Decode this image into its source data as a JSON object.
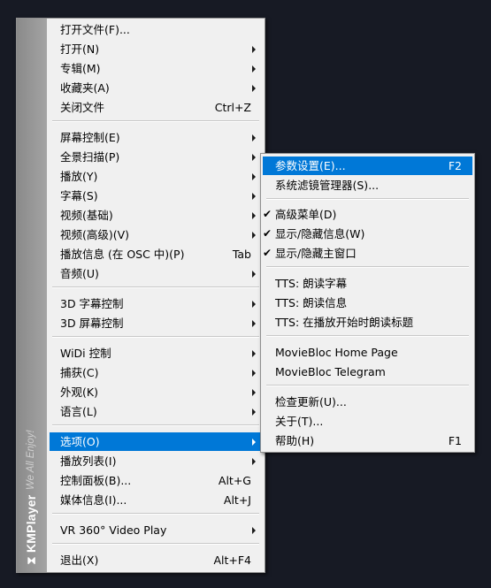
{
  "brand": {
    "logo_glyph": "⧗",
    "name": "KMPlayer",
    "tagline": "We All Enjoy!"
  },
  "main_menu": [
    {
      "label": "打开文件(F)...",
      "shortcut": "",
      "submenu": false
    },
    {
      "label": "打开(N)",
      "shortcut": "",
      "submenu": true
    },
    {
      "label": "专辑(M)",
      "shortcut": "",
      "submenu": true
    },
    {
      "label": "收藏夹(A)",
      "shortcut": "",
      "submenu": true
    },
    {
      "label": "关闭文件",
      "shortcut": "Ctrl+Z",
      "submenu": false
    },
    {
      "label": "屏幕控制(E)",
      "shortcut": "",
      "submenu": true
    },
    {
      "label": "全景扫描(P)",
      "shortcut": "",
      "submenu": true
    },
    {
      "label": "播放(Y)",
      "shortcut": "",
      "submenu": true
    },
    {
      "label": "字幕(S)",
      "shortcut": "",
      "submenu": true
    },
    {
      "label": "视频(基础)",
      "shortcut": "",
      "submenu": true
    },
    {
      "label": "视频(高级)(V)",
      "shortcut": "",
      "submenu": true
    },
    {
      "label": "播放信息 (在 OSC 中)(P)",
      "shortcut": "Tab",
      "submenu": false
    },
    {
      "label": "音频(U)",
      "shortcut": "",
      "submenu": true
    },
    {
      "label": "3D 字幕控制",
      "shortcut": "",
      "submenu": true
    },
    {
      "label": "3D 屏幕控制",
      "shortcut": "",
      "submenu": true
    },
    {
      "label": "WiDi 控制",
      "shortcut": "",
      "submenu": true
    },
    {
      "label": "捕获(C)",
      "shortcut": "",
      "submenu": true
    },
    {
      "label": "外观(K)",
      "shortcut": "",
      "submenu": true
    },
    {
      "label": "语言(L)",
      "shortcut": "",
      "submenu": true
    },
    {
      "label": "选项(O)",
      "shortcut": "",
      "submenu": true,
      "selected": true
    },
    {
      "label": "播放列表(I)",
      "shortcut": "",
      "submenu": true
    },
    {
      "label": "控制面板(B)...",
      "shortcut": "Alt+G",
      "submenu": false
    },
    {
      "label": "媒体信息(I)...",
      "shortcut": "Alt+J",
      "submenu": false
    },
    {
      "label": "VR 360° Video Play",
      "shortcut": "",
      "submenu": true
    },
    {
      "label": "退出(X)",
      "shortcut": "Alt+F4",
      "submenu": false
    }
  ],
  "sub_menu": [
    {
      "label": "参数设置(E)...",
      "shortcut": "F2",
      "checked": false,
      "selected": true
    },
    {
      "label": "系统滤镜管理器(S)...",
      "shortcut": "",
      "checked": false
    },
    {
      "label": "高级菜单(D)",
      "shortcut": "",
      "checked": true
    },
    {
      "label": "显示/隐藏信息(W)",
      "shortcut": "",
      "checked": true
    },
    {
      "label": "显示/隐藏主窗口",
      "shortcut": "",
      "checked": true
    },
    {
      "label": "TTS: 朗读字幕",
      "shortcut": "",
      "checked": false
    },
    {
      "label": "TTS: 朗读信息",
      "shortcut": "",
      "checked": false
    },
    {
      "label": "TTS: 在播放开始时朗读标题",
      "shortcut": "",
      "checked": false
    },
    {
      "label": "MovieBloc Home Page",
      "shortcut": "",
      "checked": false
    },
    {
      "label": "MovieBloc Telegram",
      "shortcut": "",
      "checked": false
    },
    {
      "label": "检查更新(U)...",
      "shortcut": "",
      "checked": false
    },
    {
      "label": "关于(T)...",
      "shortcut": "",
      "checked": false
    },
    {
      "label": "帮助(H)",
      "shortcut": "F1",
      "checked": false
    }
  ],
  "check_glyph": "✔"
}
